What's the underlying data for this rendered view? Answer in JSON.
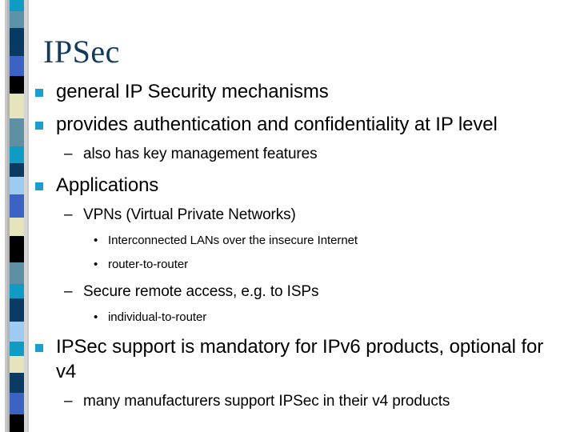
{
  "slide": {
    "title": "IPSec",
    "title_color": "#123a5f",
    "bullet_color": "#1b9dd0",
    "background_color": "#ffffff",
    "text_color": "#000000"
  },
  "markers": {
    "square": "",
    "dash": "–",
    "dot": "•"
  },
  "content": [
    {
      "level": 1,
      "text": "general IP Security mechanisms"
    },
    {
      "level": 1,
      "text": "provides authentication and confidentiality at IP level"
    },
    {
      "level": 2,
      "text": "also has key management features"
    },
    {
      "level": 1,
      "text": "Applications"
    },
    {
      "level": 2,
      "text": "VPNs (Virtual Private Networks)"
    },
    {
      "level": 3,
      "text": "Interconnected LANs over the insecure Internet"
    },
    {
      "level": 3,
      "text": "router-to-router"
    },
    {
      "level": 2,
      "text": "Secure remote access, e.g. to ISPs"
    },
    {
      "level": 3,
      "text": "individual-to-router"
    },
    {
      "level": 1,
      "text": "IPSec support is mandatory for IPv6 products, optional for v4"
    },
    {
      "level": 2,
      "text": "many manufacturers support IPSec in their v4 products"
    }
  ],
  "decor_band": {
    "name": "vertical-color-bar",
    "segments": [
      {
        "color": "#0f9bc4",
        "h": 14
      },
      {
        "color": "#5d93a8",
        "h": 22
      },
      {
        "color": "#073a63",
        "h": 24
      },
      {
        "color": "#0a3a62",
        "h": 12
      },
      {
        "color": "#3b63c4",
        "h": 26
      },
      {
        "color": "#000000",
        "h": 22
      },
      {
        "color": "#e6e4bc",
        "h": 32
      },
      {
        "color": "#5f8fa3",
        "h": 36
      },
      {
        "color": "#0f9bc4",
        "h": 22
      },
      {
        "color": "#0b3a63",
        "h": 18
      },
      {
        "color": "#9ecbf0",
        "h": 22
      },
      {
        "color": "#3b63c4",
        "h": 30
      },
      {
        "color": "#e6e4bc",
        "h": 24
      },
      {
        "color": "#000000",
        "h": 34
      },
      {
        "color": "#5f8fa3",
        "h": 28
      },
      {
        "color": "#0f9bc4",
        "h": 18
      },
      {
        "color": "#0b3a63",
        "h": 30
      },
      {
        "color": "#9ecbf0",
        "h": 26
      },
      {
        "color": "#0f9bc4",
        "h": 18
      },
      {
        "color": "#e6e4bc",
        "h": 22
      },
      {
        "color": "#0b3a63",
        "h": 26
      },
      {
        "color": "#3b63c4",
        "h": 28
      },
      {
        "color": "#000000",
        "h": 22
      }
    ]
  }
}
